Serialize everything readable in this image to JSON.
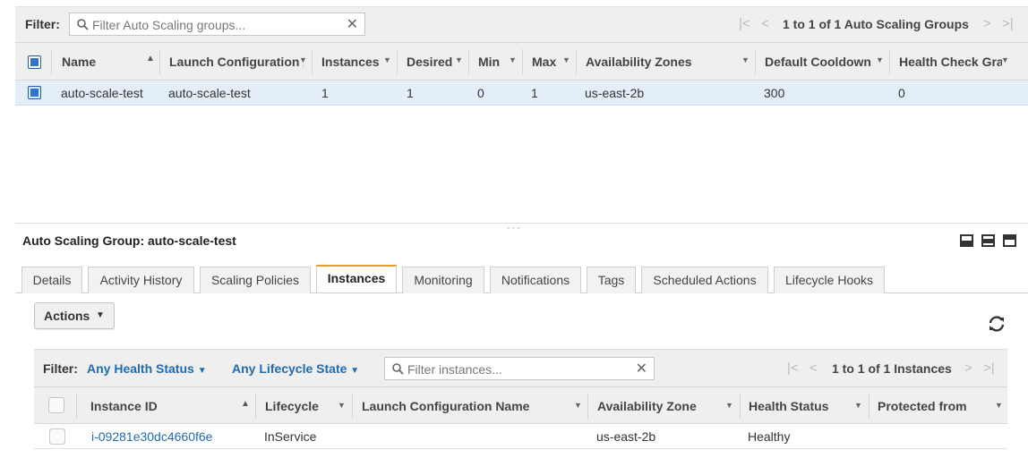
{
  "groups_grid": {
    "filter_label": "Filter:",
    "search_placeholder": "Filter Auto Scaling groups...",
    "pager_text": "1 to 1 of 1 Auto Scaling Groups",
    "columns": [
      "Name",
      "Launch Configuration /",
      "Instances",
      "Desired",
      "Min",
      "Max",
      "Availability Zones",
      "Default Cooldown",
      "Health Check Grac"
    ],
    "rows": [
      {
        "name": "auto-scale-test",
        "launch_config": "auto-scale-test",
        "instances": "1",
        "desired": "1",
        "min": "0",
        "max": "1",
        "zones": "us-east-2b",
        "cooldown": "300",
        "health_grace": "0",
        "selected": true
      }
    ]
  },
  "splitter_dots": "◦◦◦",
  "detail": {
    "title": "Auto Scaling Group: auto-scale-test",
    "tabs": [
      "Details",
      "Activity History",
      "Scaling Policies",
      "Instances",
      "Monitoring",
      "Notifications",
      "Tags",
      "Scheduled Actions",
      "Lifecycle Hooks"
    ],
    "active_tab": "Instances",
    "actions_label": "Actions"
  },
  "instances_grid": {
    "filter_label": "Filter:",
    "health_filter": "Any Health Status",
    "lifecycle_filter": "Any Lifecycle State",
    "search_placeholder": "Filter instances...",
    "pager_text": "1 to 1 of 1 Instances",
    "columns": [
      "Instance ID",
      "Lifecycle",
      "Launch Configuration Name",
      "Availability Zone",
      "Health Status",
      "Protected from"
    ],
    "rows": [
      {
        "instance_id": "i-09281e30dc4660f6e",
        "lifecycle": "InService",
        "launch_config": "",
        "zone": "us-east-2b",
        "health": "Healthy",
        "protected": ""
      }
    ]
  },
  "icons": {
    "search": "search-icon",
    "clear": "clear-icon",
    "first_page": "first-page-icon",
    "prev_page": "prev-page-icon",
    "next_page": "next-page-icon",
    "last_page": "last-page-icon",
    "refresh": "refresh-icon"
  },
  "colors": {
    "accent_tab": "#e89e2c",
    "link": "#1f6bb0",
    "selected_row": "#e3eef8",
    "checkbox": "#2f75c9"
  }
}
